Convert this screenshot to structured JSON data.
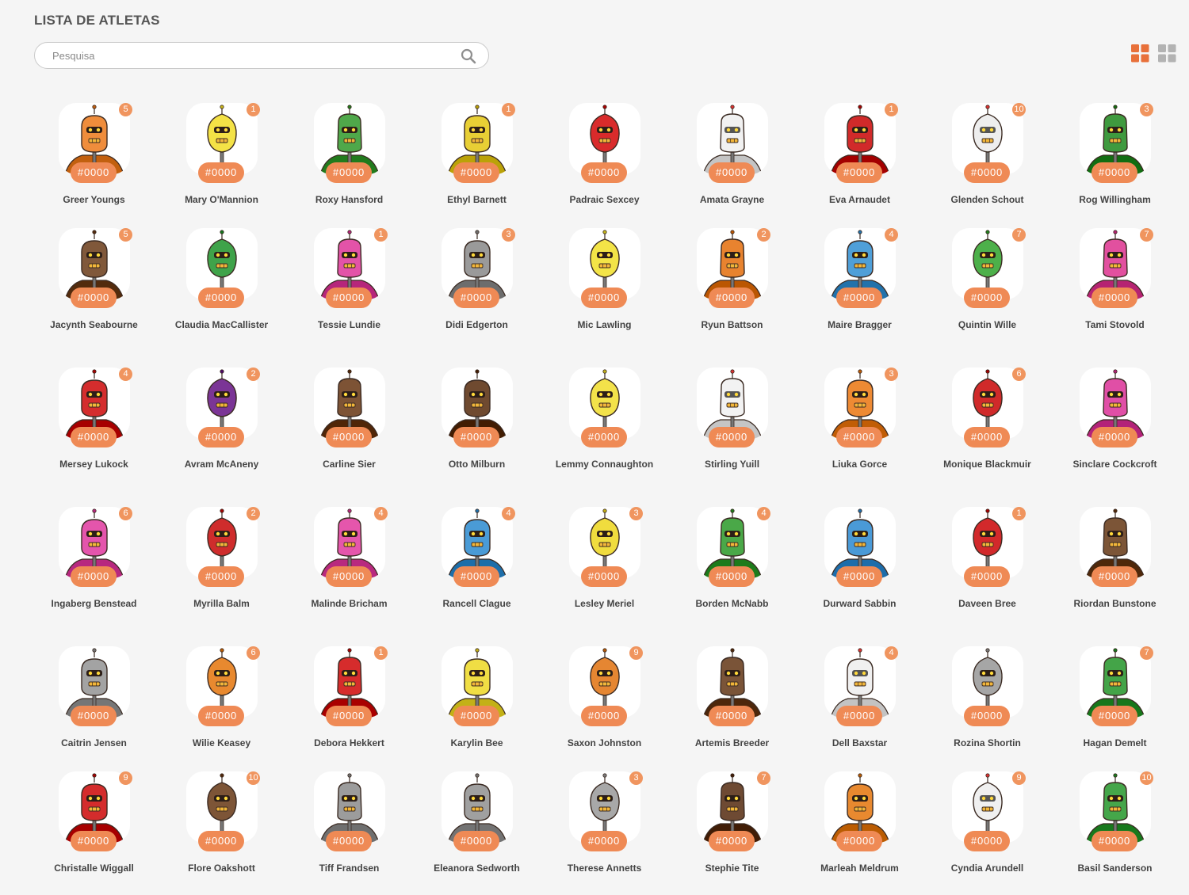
{
  "page": {
    "title": "LISTA DE ATLETAS"
  },
  "search": {
    "placeholder": "Pesquisa",
    "icon": "search-icon"
  },
  "view_toggle": {
    "active_color": "#e8703a",
    "inactive_color": "#b3b3b3",
    "options": [
      {
        "name": "grid-view",
        "active": true
      },
      {
        "name": "list-view",
        "active": false
      }
    ]
  },
  "accent_color": "#ef8a55",
  "athletes": [
    {
      "name": "Greer Youngs",
      "code": "#0000",
      "badge": "5",
      "color": "#ef8d3c"
    },
    {
      "name": "Mary O'Mannion",
      "code": "#0000",
      "badge": "1",
      "color": "#f4e246"
    },
    {
      "name": "Roxy Hansford",
      "code": "#0000",
      "badge": "",
      "color": "#4fa84a"
    },
    {
      "name": "Ethyl Barnett",
      "code": "#0000",
      "badge": "1",
      "color": "#e8cf35"
    },
    {
      "name": "Padraic Sexcey",
      "code": "#0000",
      "badge": "",
      "color": "#d92b2b"
    },
    {
      "name": "Amata Grayne",
      "code": "#0000",
      "badge": "",
      "color": "#f1f1f1"
    },
    {
      "name": "Eva Arnaudet",
      "code": "#0000",
      "badge": "1",
      "color": "#d12a2a"
    },
    {
      "name": "Glenden Schout",
      "code": "#0000",
      "badge": "10",
      "color": "#eeeeee"
    },
    {
      "name": "Rog Willingham",
      "code": "#0000",
      "badge": "3",
      "color": "#3f9a3f"
    },
    {
      "name": "Jacynth Seabourne",
      "code": "#0000",
      "badge": "5",
      "color": "#80583a"
    },
    {
      "name": "Claudia MacCallister",
      "code": "#0000",
      "badge": "",
      "color": "#3fa34a"
    },
    {
      "name": "Tessie Lundie",
      "code": "#0000",
      "badge": "1",
      "color": "#e353a8"
    },
    {
      "name": "Didi Edgerton",
      "code": "#0000",
      "badge": "3",
      "color": "#9a9a9a"
    },
    {
      "name": "Mic Lawling",
      "code": "#0000",
      "badge": "",
      "color": "#f3e447"
    },
    {
      "name": "Ryun Battson",
      "code": "#0000",
      "badge": "2",
      "color": "#e8832f"
    },
    {
      "name": "Maire Bragger",
      "code": "#0000",
      "badge": "4",
      "color": "#4f9fd8"
    },
    {
      "name": "Quintin Wille",
      "code": "#0000",
      "badge": "7",
      "color": "#4db04a"
    },
    {
      "name": "Tami Stovold",
      "code": "#0000",
      "badge": "7",
      "color": "#e2509f"
    },
    {
      "name": "Mersey Lukock",
      "code": "#0000",
      "badge": "4",
      "color": "#d42d2d"
    },
    {
      "name": "Avram McAneny",
      "code": "#0000",
      "badge": "2",
      "color": "#7b3596"
    },
    {
      "name": "Carline Sier",
      "code": "#0000",
      "badge": "",
      "color": "#7d5335"
    },
    {
      "name": "Otto Milburn",
      "code": "#0000",
      "badge": "",
      "color": "#6f4a30"
    },
    {
      "name": "Lemmy Connaughton",
      "code": "#0000",
      "badge": "",
      "color": "#f3e24a"
    },
    {
      "name": "Stirling Yuill",
      "code": "#0000",
      "badge": "",
      "color": "#f2f2f2"
    },
    {
      "name": "Liuka Gorce",
      "code": "#0000",
      "badge": "3",
      "color": "#ee8a33"
    },
    {
      "name": "Monique Blackmuir",
      "code": "#0000",
      "badge": "6",
      "color": "#d02a2a"
    },
    {
      "name": "Sinclare Cockcroft",
      "code": "#0000",
      "badge": "",
      "color": "#e04fa6"
    },
    {
      "name": "Ingaberg Benstead",
      "code": "#0000",
      "badge": "6",
      "color": "#e455ac"
    },
    {
      "name": "Myrilla Balm",
      "code": "#0000",
      "badge": "2",
      "color": "#cf2c2c"
    },
    {
      "name": "Malinde Bricham",
      "code": "#0000",
      "badge": "4",
      "color": "#e556ac"
    },
    {
      "name": "Rancell Clague",
      "code": "#0000",
      "badge": "4",
      "color": "#4a9bd6"
    },
    {
      "name": "Lesley Meriel",
      "code": "#0000",
      "badge": "3",
      "color": "#f0dc3e"
    },
    {
      "name": "Borden McNabb",
      "code": "#0000",
      "badge": "4",
      "color": "#4aa848"
    },
    {
      "name": "Durward Sabbin",
      "code": "#0000",
      "badge": "",
      "color": "#4a9ad7"
    },
    {
      "name": "Daveen Bree",
      "code": "#0000",
      "badge": "1",
      "color": "#d2292b"
    },
    {
      "name": "Riordan Bunstone",
      "code": "#0000",
      "badge": "",
      "color": "#7c5537"
    },
    {
      "name": "Caitrin Jensen",
      "code": "#0000",
      "badge": "",
      "color": "#a3a3a3"
    },
    {
      "name": "Wilie Keasey",
      "code": "#0000",
      "badge": "6",
      "color": "#e8892f"
    },
    {
      "name": "Debora Hekkert",
      "code": "#0000",
      "badge": "1",
      "color": "#d62c2c"
    },
    {
      "name": "Karylin Bee",
      "code": "#0000",
      "badge": "",
      "color": "#f0de44"
    },
    {
      "name": "Saxon Johnston",
      "code": "#0000",
      "badge": "9",
      "color": "#e58632"
    },
    {
      "name": "Artemis Breeder",
      "code": "#0000",
      "badge": "",
      "color": "#7a5438"
    },
    {
      "name": "Dell Baxstar",
      "code": "#0000",
      "badge": "4",
      "color": "#f0f0f0"
    },
    {
      "name": "Rozina Shortin",
      "code": "#0000",
      "badge": "",
      "color": "#a6a6a6"
    },
    {
      "name": "Hagan Demelt",
      "code": "#0000",
      "badge": "7",
      "color": "#44a448"
    },
    {
      "name": "Christalle Wiggall",
      "code": "#0000",
      "badge": "9",
      "color": "#d42c2c"
    },
    {
      "name": "Flore Oakshott",
      "code": "#0000",
      "badge": "10",
      "color": "#7d5537"
    },
    {
      "name": "Tiff Frandsen",
      "code": "#0000",
      "badge": "",
      "color": "#9c9c9c"
    },
    {
      "name": "Eleanora Sedworth",
      "code": "#0000",
      "badge": "",
      "color": "#a0a0a0"
    },
    {
      "name": "Therese Annetts",
      "code": "#0000",
      "badge": "3",
      "color": "#a8a8a8"
    },
    {
      "name": "Stephie Tite",
      "code": "#0000",
      "badge": "7",
      "color": "#6e4a33"
    },
    {
      "name": "Marleah Meldrum",
      "code": "#0000",
      "badge": "",
      "color": "#e8892f"
    },
    {
      "name": "Cyndia Arundell",
      "code": "#0000",
      "badge": "9",
      "color": "#f0f0f0"
    },
    {
      "name": "Basil Sanderson",
      "code": "#0000",
      "badge": "10",
      "color": "#45a64a"
    }
  ]
}
